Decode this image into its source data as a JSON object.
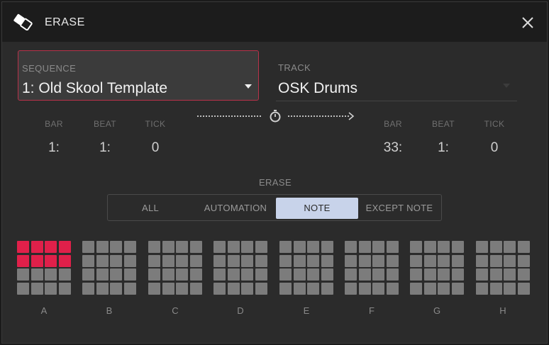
{
  "dialog": {
    "title": "ERASE",
    "icon": "eraser-icon",
    "close_icon": "close-icon"
  },
  "sequence": {
    "label": "SEQUENCE",
    "value": "1: Old Skool Template"
  },
  "track": {
    "label": "TRACK",
    "value": "OSK Drums"
  },
  "time_range": {
    "start": {
      "bar_label": "BAR",
      "beat_label": "BEAT",
      "tick_label": "TICK",
      "bar": "1:",
      "beat": "1:",
      "tick": "0"
    },
    "end": {
      "bar_label": "BAR",
      "beat_label": "BEAT",
      "tick_label": "TICK",
      "bar": "33:",
      "beat": "1:",
      "tick": "0"
    },
    "icon": "stopwatch-icon"
  },
  "erase_mode": {
    "label": "ERASE",
    "options": [
      "ALL",
      "AUTOMATION",
      "NOTE",
      "EXCEPT NOTE"
    ],
    "selected": "NOTE"
  },
  "pad_banks": [
    {
      "label": "A",
      "active_rows": 2
    },
    {
      "label": "B",
      "active_rows": 0
    },
    {
      "label": "C",
      "active_rows": 0
    },
    {
      "label": "D",
      "active_rows": 0
    },
    {
      "label": "E",
      "active_rows": 0
    },
    {
      "label": "F",
      "active_rows": 0
    },
    {
      "label": "G",
      "active_rows": 0
    },
    {
      "label": "H",
      "active_rows": 0
    }
  ],
  "colors": {
    "accent": "#e0204a",
    "selected_segment": "#c8d3ea",
    "pad_off": "#7c7c7c",
    "background": "#2b2b2b"
  }
}
